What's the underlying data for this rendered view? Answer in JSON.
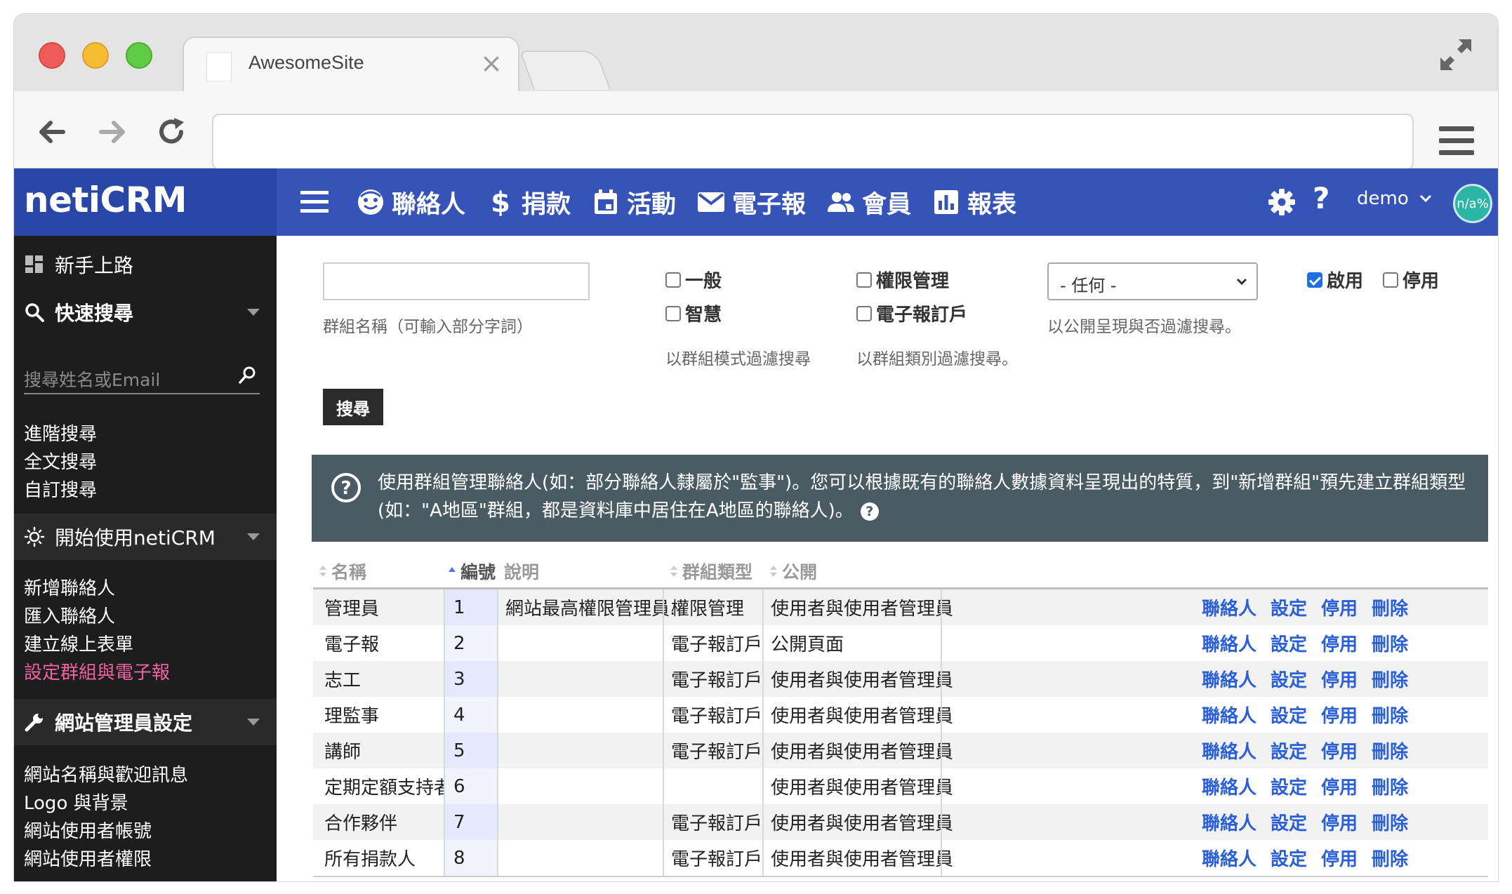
{
  "browser": {
    "tab_title": "AwesomeSite",
    "tab_close": "×"
  },
  "app": {
    "brand": "netiCRM",
    "nav": [
      {
        "label": "聯絡人",
        "icon": "smiley-icon"
      },
      {
        "label": "捐款",
        "icon": "dollar-icon"
      },
      {
        "label": "活動",
        "icon": "calendar-icon"
      },
      {
        "label": "電子報",
        "icon": "envelope-icon"
      },
      {
        "label": "會員",
        "icon": "people-icon"
      },
      {
        "label": "報表",
        "icon": "bar-chart-icon"
      }
    ],
    "help": "?",
    "user": "demo",
    "avatar": "n/a%"
  },
  "sidebar": {
    "getting_started": "新手上路",
    "quick_search": "快速搜尋",
    "search_placeholder": "搜尋姓名或Email",
    "search_links": [
      "進階搜尋",
      "全文搜尋",
      "自訂搜尋"
    ],
    "start_section": "開始使用netiCRM",
    "start_links": [
      "新增聯絡人",
      "匯入聯絡人",
      "建立線上表單",
      "設定群組與電子報"
    ],
    "active_link": "設定群組與電子報",
    "admin_section": "網站管理員設定",
    "admin_links": [
      "網站名稱與歡迎訊息",
      "Logo 與背景",
      "網站使用者帳號",
      "網站使用者權限"
    ]
  },
  "filters": {
    "name_help": "群組名稱（可輸入部分字詞）",
    "mode_options": [
      "一般",
      "智慧"
    ],
    "mode_help": "以群組模式過濾搜尋",
    "type_options": [
      "權限管理",
      "電子報訂戶"
    ],
    "type_help": "以群組類別過濾搜尋。",
    "visibility_value": "- 任何 -",
    "visibility_help": "以公開呈現與否過濾搜尋。",
    "status_options": [
      {
        "label": "啟用",
        "checked": true
      },
      {
        "label": "停用",
        "checked": false
      }
    ],
    "search_button": "搜尋"
  },
  "info": {
    "text": "使用群組管理聯絡人(如：部分聯絡人隸屬於\"監事\")。您可以根據既有的聯絡人數據資料呈現出的特質，到\"新增群組\"預先建立群組類型(如：\"A地區\"群組，都是資料庫中居住在A地區的聯絡人)。",
    "help_badge": "?"
  },
  "table": {
    "headers": {
      "name": "名稱",
      "id": "編號",
      "desc": "說明",
      "type": "群組類型",
      "visibility": "公開"
    },
    "sorted_by": "編號",
    "actions": [
      "聯絡人",
      "設定",
      "停用",
      "刪除"
    ],
    "rows": [
      {
        "name": "管理員",
        "id": "1",
        "desc": "網站最高權限管理員.",
        "type": "權限管理",
        "visibility": "使用者與使用者管理員"
      },
      {
        "name": "電子報",
        "id": "2",
        "desc": "",
        "type": "電子報訂戶",
        "visibility": "公開頁面"
      },
      {
        "name": "志工",
        "id": "3",
        "desc": "",
        "type": "電子報訂戶",
        "visibility": "使用者與使用者管理員"
      },
      {
        "name": "理監事",
        "id": "4",
        "desc": "",
        "type": "電子報訂戶",
        "visibility": "使用者與使用者管理員"
      },
      {
        "name": "講師",
        "id": "5",
        "desc": "",
        "type": "電子報訂戶",
        "visibility": "使用者與使用者管理員"
      },
      {
        "name": "定期定額支持者",
        "id": "6",
        "desc": "",
        "type": "",
        "visibility": "使用者與使用者管理員"
      },
      {
        "name": "合作夥伴",
        "id": "7",
        "desc": "",
        "type": "電子報訂戶",
        "visibility": "使用者與使用者管理員"
      },
      {
        "name": "所有捐款人",
        "id": "8",
        "desc": "",
        "type": "電子報訂戶",
        "visibility": "使用者與使用者管理員"
      }
    ]
  },
  "colors": {
    "appbar": "#3653b8",
    "brand_bg": "#2a47a8",
    "sidebar_bg": "#1d1d1d",
    "active_link": "#f062a0",
    "action_link": "#2a5fd6",
    "info_bg": "#4b5b63"
  }
}
